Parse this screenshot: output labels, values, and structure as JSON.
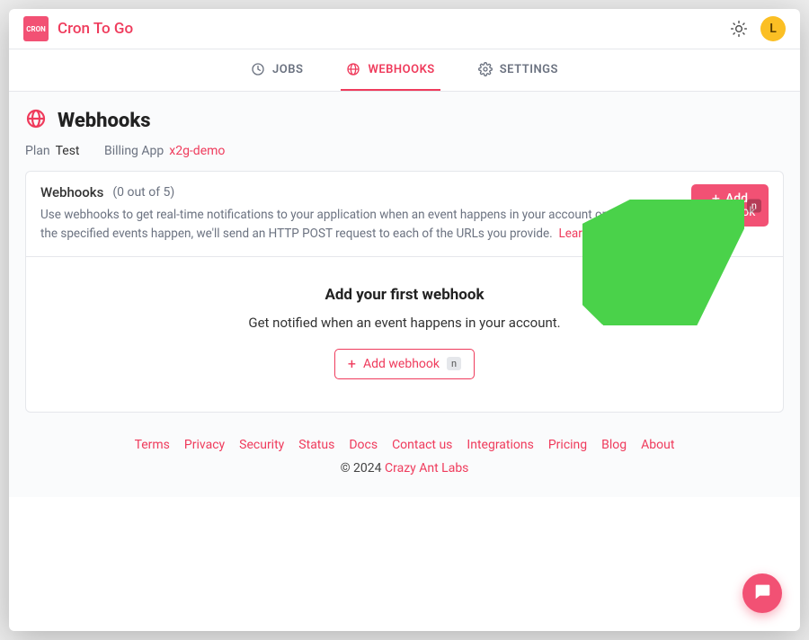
{
  "brand": {
    "logo_text": "CRON",
    "name": "Cron To Go",
    "avatar_initial": "L"
  },
  "tabs": {
    "jobs": "JOBS",
    "webhooks": "WEBHOOKS",
    "settings": "SETTINGS"
  },
  "page": {
    "title": "Webhooks",
    "plan_label": "Plan",
    "plan_value": "Test",
    "billing_label": "Billing App",
    "billing_value": "x2g-demo"
  },
  "card": {
    "name": "Webhooks",
    "count": "(0 out of 5)",
    "desc": "Use webhooks to get real-time notifications to your application when an event happens in your account or jobs. When the specified events happen, we'll send an HTTP POST request to each of the URLs you provide.",
    "learn_more": "Learn more",
    "learn_more_suffix": ".",
    "add_btn_prefix": "Add",
    "add_btn_suffix": "webhook",
    "kbd": "n"
  },
  "empty": {
    "title": "Add your first webhook",
    "sub": "Get notified when an event happens in your account.",
    "btn": "Add webhook",
    "kbd": "n"
  },
  "footer": {
    "links": [
      "Terms",
      "Privacy",
      "Security",
      "Status",
      "Docs",
      "Contact us",
      "Integrations",
      "Pricing",
      "Blog",
      "About"
    ],
    "copyright_prefix": "© 2024 ",
    "company": "Crazy Ant Labs"
  },
  "icons": {
    "sun": "theme-toggle-icon",
    "globe": "globe-icon",
    "clock": "clock-icon",
    "gear": "gear-icon",
    "plus": "plus-icon",
    "chat": "chat-icon"
  }
}
